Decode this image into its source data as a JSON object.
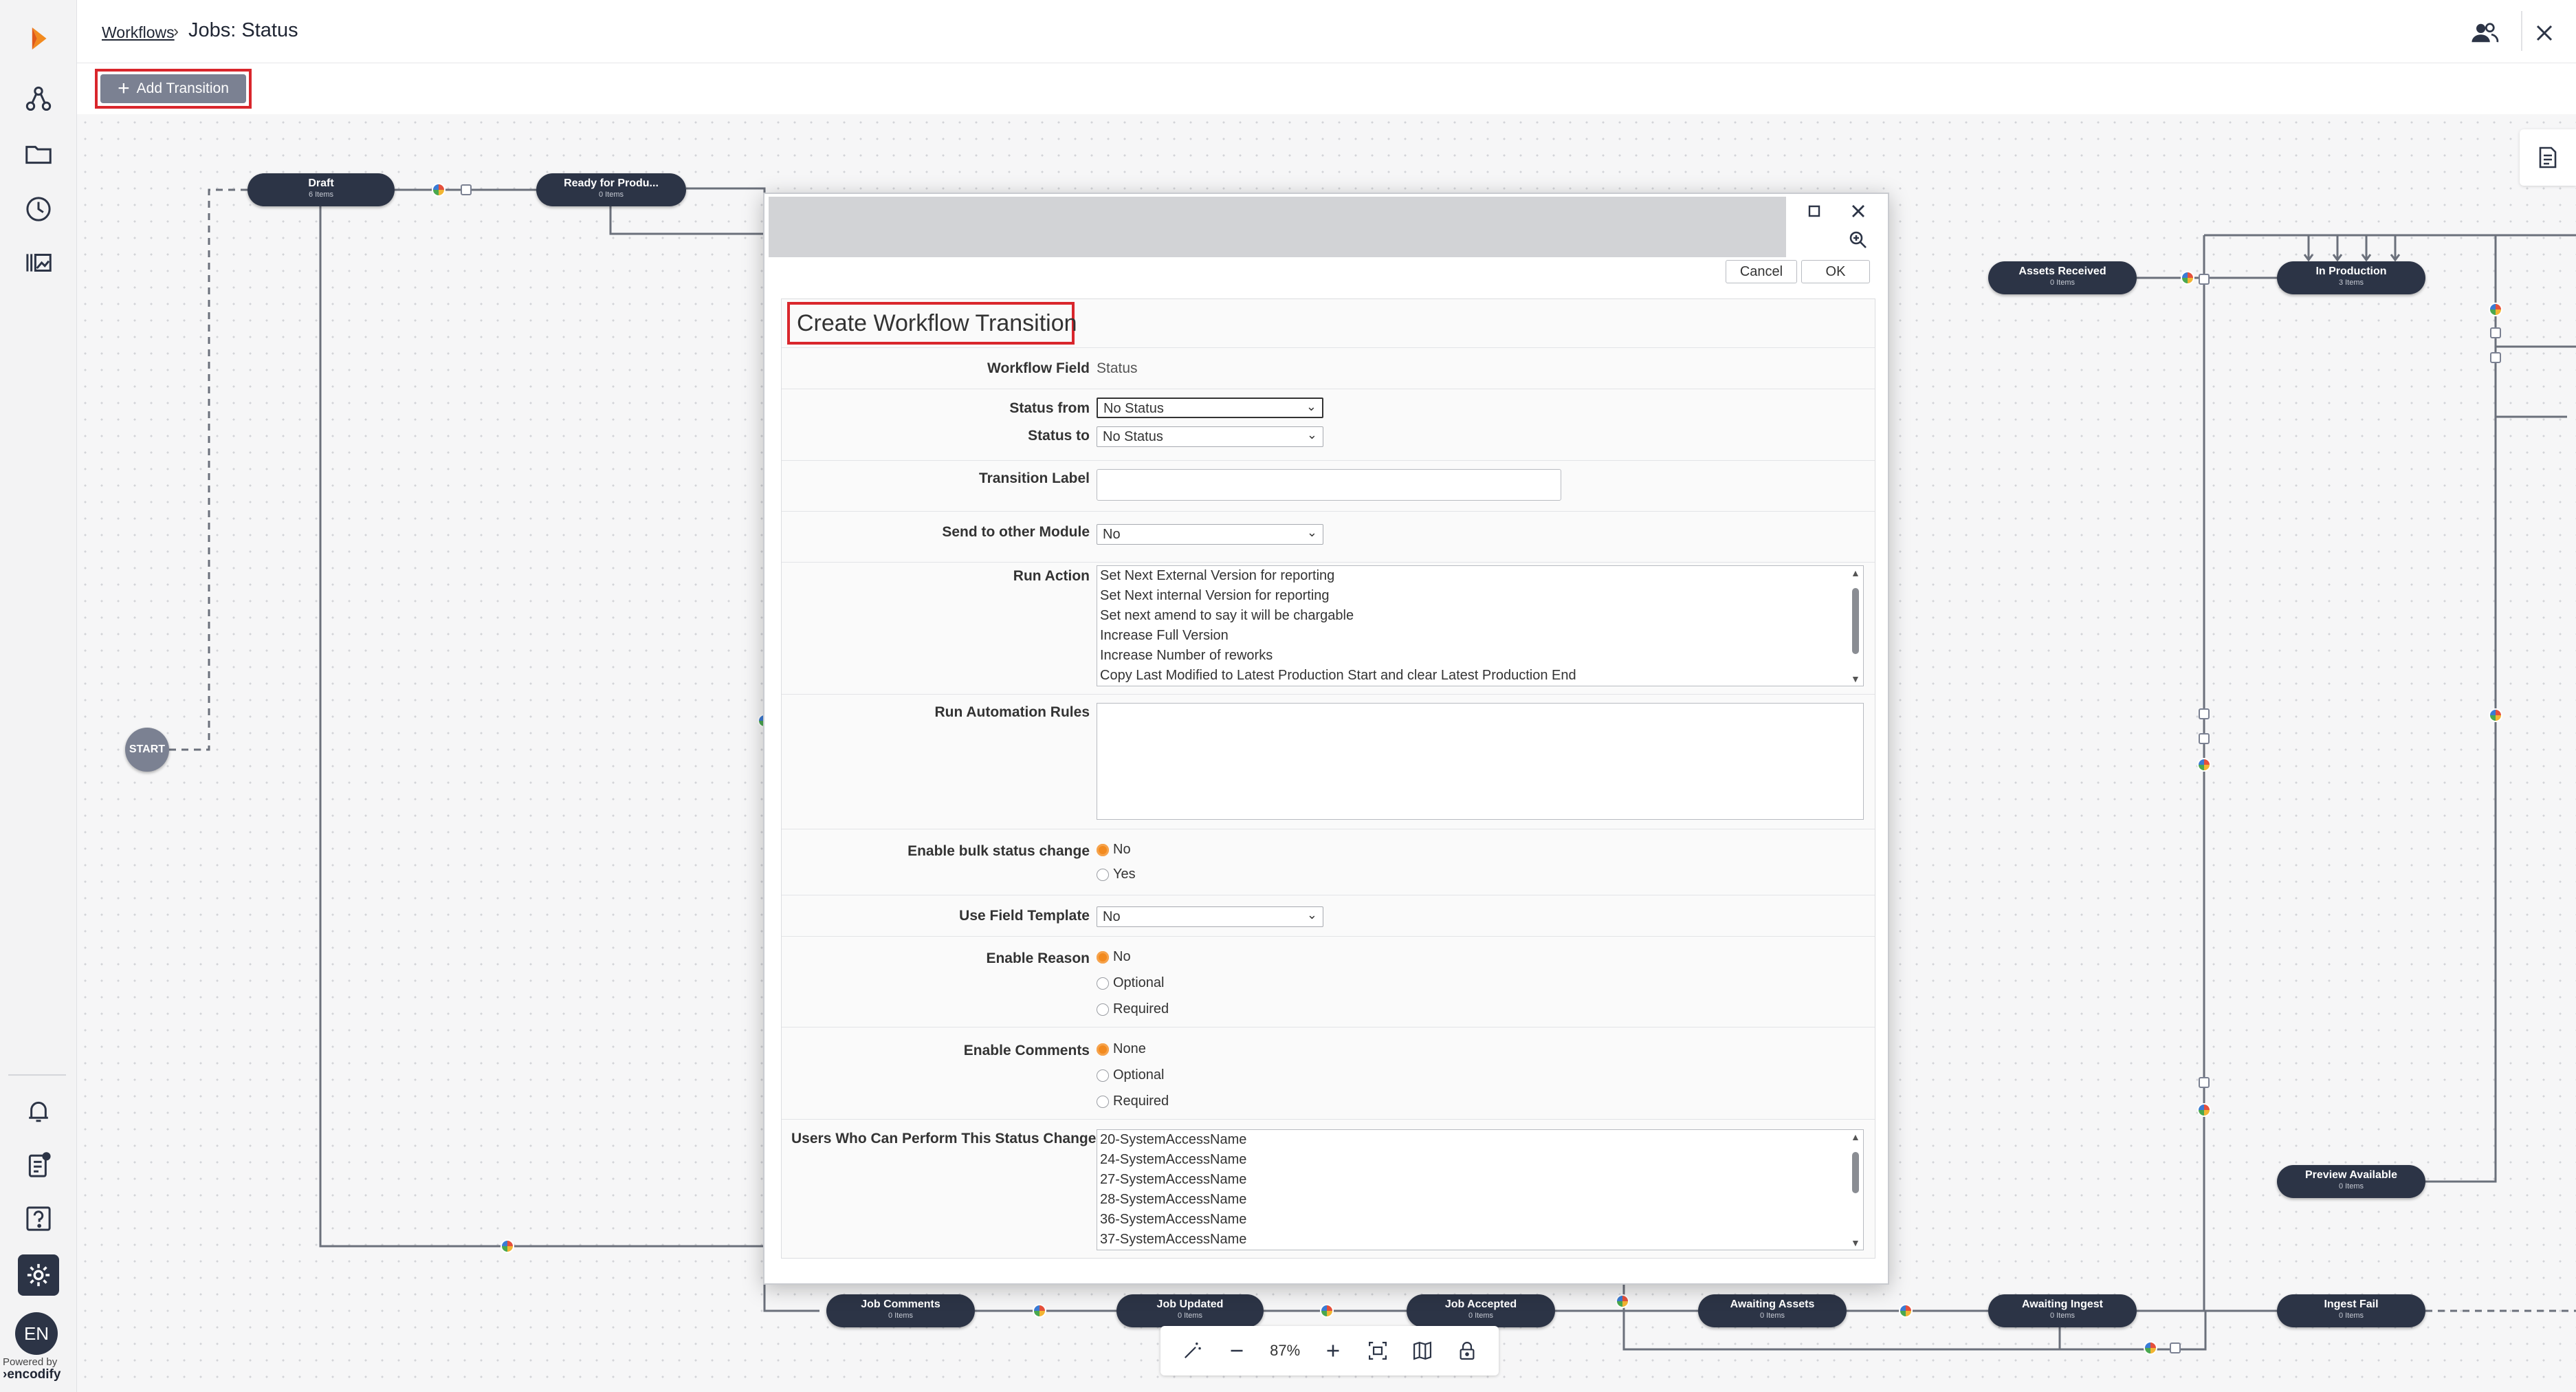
{
  "header": {
    "breadcrumb_link": "Workflows",
    "breadcrumb_sep": "›",
    "title": "Jobs: Status"
  },
  "toolbar": {
    "add_transition_label": "Add Transition",
    "add_icon": "plus-icon"
  },
  "sidebar": {
    "icons": [
      "logo-icon",
      "workflow-icon",
      "folder-icon",
      "clock-icon",
      "library-icon",
      "bell-icon",
      "tasks-icon",
      "help-icon",
      "gear-icon"
    ],
    "language": "EN",
    "powered_by": "Powered by",
    "brand": "encodify"
  },
  "canvas": {
    "start_label": "START",
    "nodes": [
      {
        "name": "Draft",
        "count": "6 Items"
      },
      {
        "name": "Ready for Produ...",
        "count": "0 Items"
      },
      {
        "name": "Assets Received",
        "count": "0 Items"
      },
      {
        "name": "In Production",
        "count": "3 Items"
      },
      {
        "name": "Preview Available",
        "count": "0 Items"
      },
      {
        "name": "Job Comments",
        "count": "0 Items"
      },
      {
        "name": "Job Updated",
        "count": "0 Items"
      },
      {
        "name": "Job Accepted",
        "count": "0 Items"
      },
      {
        "name": "Awaiting Assets",
        "count": "0 Items"
      },
      {
        "name": "Awaiting Ingest",
        "count": "0 Items"
      },
      {
        "name": "Ingest Fail",
        "count": "0 Items"
      }
    ]
  },
  "zoom": {
    "level": "87%"
  },
  "modal": {
    "cancel_label": "Cancel",
    "ok_label": "OK",
    "form_title": "Create Workflow Transition",
    "workflow_field_label": "Workflow Field",
    "workflow_field_value": "Status",
    "status_from_label": "Status from",
    "status_from_value": "No Status",
    "status_to_label": "Status to",
    "status_to_value": "No Status",
    "transition_label_label": "Transition Label",
    "transition_label_value": "",
    "send_module_label": "Send to other Module",
    "send_module_value": "No",
    "run_action_label": "Run Action",
    "run_action_items": [
      "Set Next External Version for reporting",
      "Set Next internal Version for reporting",
      "Set next amend to say it will be chargable",
      "Increase Full Version",
      "Increase Number of reworks",
      "Copy Last Modified to Latest Production Start and clear Latest Production End"
    ],
    "run_automation_label": "Run Automation Rules",
    "bulk_label": "Enable bulk status change",
    "bulk_options": [
      "No",
      "Yes"
    ],
    "field_template_label": "Use Field Template",
    "field_template_value": "No",
    "reason_label": "Enable Reason",
    "reason_options": [
      "No",
      "Optional",
      "Required"
    ],
    "comments_label": "Enable Comments",
    "comments_options": [
      "None",
      "Optional",
      "Required"
    ],
    "users_label": "Users Who Can Perform This Status Change",
    "users_items": [
      "20-SystemAccessName",
      "24-SystemAccessName",
      "27-SystemAccessName",
      "28-SystemAccessName",
      "36-SystemAccessName",
      "37-SystemAccessName"
    ]
  }
}
